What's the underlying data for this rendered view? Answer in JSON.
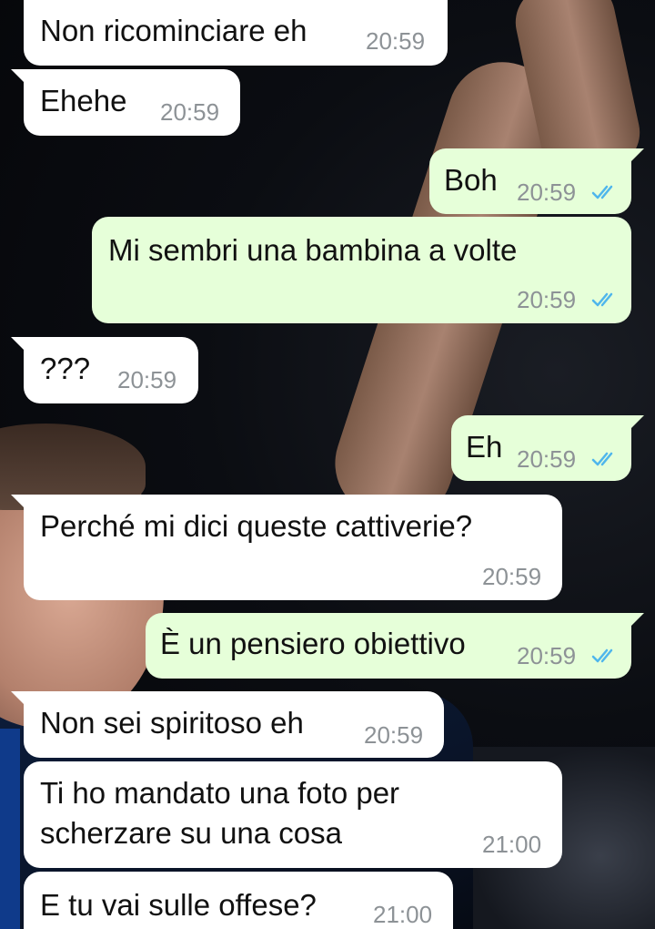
{
  "colors": {
    "incoming_bubble": "#ffffff",
    "outgoing_bubble": "#e6ffd9",
    "timestamp": "#8d9296",
    "read_ticks": "#4fb6ec"
  },
  "messages": [
    {
      "direction": "incoming",
      "text": "Non ricominciare eh",
      "time": "20:59"
    },
    {
      "direction": "incoming",
      "text": "Ehehe",
      "time": "20:59"
    },
    {
      "direction": "outgoing",
      "text": "Boh",
      "time": "20:59",
      "status": "read"
    },
    {
      "direction": "outgoing",
      "text": "Mi sembri una bambina a volte",
      "time": "20:59",
      "status": "read"
    },
    {
      "direction": "incoming",
      "text": "???",
      "time": "20:59"
    },
    {
      "direction": "outgoing",
      "text": "Eh",
      "time": "20:59",
      "status": "read"
    },
    {
      "direction": "incoming",
      "text": "Perché mi dici queste cattiverie?",
      "time": "20:59"
    },
    {
      "direction": "outgoing",
      "text": "È un pensiero obiettivo",
      "time": "20:59",
      "status": "read"
    },
    {
      "direction": "incoming",
      "text": "Non sei spiritoso eh",
      "time": "20:59"
    },
    {
      "direction": "incoming",
      "text_line1": "Ti ho mandato una foto per",
      "text_line2": "scherzare su una cosa",
      "time": "21:00"
    },
    {
      "direction": "incoming",
      "text": "E tu vai sulle offese?",
      "time": "21:00"
    }
  ]
}
